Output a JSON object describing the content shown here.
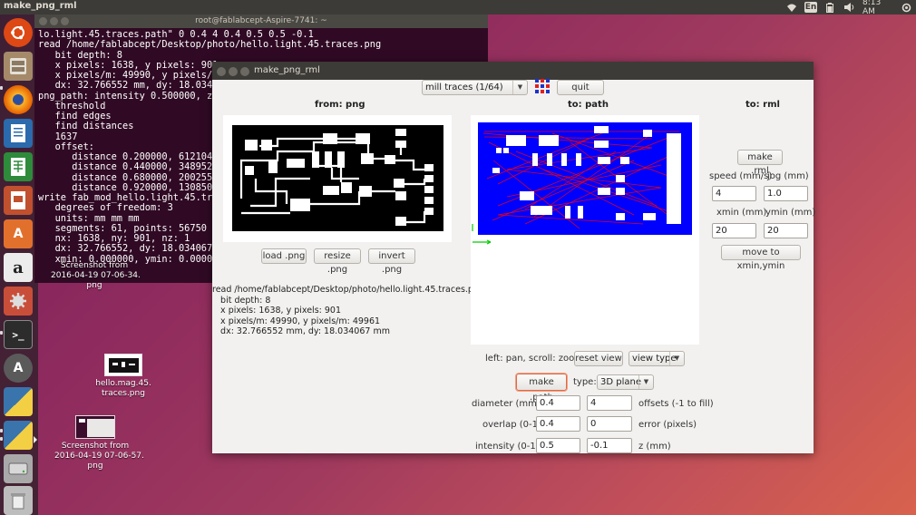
{
  "top_panel": {
    "title": "make_png_rml",
    "keyboard": "En",
    "time": "8:13 AM"
  },
  "launcher": {
    "items": [
      {
        "name": "ubuntu-dash",
        "icon": "ubuntu-logo-icon",
        "color": "#e0652c"
      },
      {
        "name": "files",
        "icon": "file-cabinet-icon",
        "color": "#8a6e55"
      },
      {
        "name": "firefox",
        "icon": "firefox-icon",
        "color": "#e66000"
      },
      {
        "name": "writer",
        "icon": "document-writer-icon",
        "color": "#2a6aad"
      },
      {
        "name": "calc",
        "icon": "spreadsheet-calc-icon",
        "color": "#2e8b3b"
      },
      {
        "name": "impress",
        "icon": "presentation-impress-icon",
        "color": "#c0502e"
      },
      {
        "name": "software-center",
        "icon": "shopping-bag-icon",
        "color": "#e2702d"
      },
      {
        "name": "amazon",
        "icon": "amazon-icon",
        "color": "#e9e9e9"
      },
      {
        "name": "settings",
        "icon": "gear-icon",
        "color": "#c94e39"
      },
      {
        "name": "terminal",
        "icon": "terminal-icon",
        "color": "#2c2c2c"
      },
      {
        "name": "updater",
        "icon": "update-icon",
        "color": "#6d6d6d"
      },
      {
        "name": "python-a",
        "icon": "python-icon",
        "color": "#3a74ad"
      },
      {
        "name": "python-b",
        "icon": "python-icon",
        "color": "#3a74ad"
      },
      {
        "name": "drive",
        "icon": "disk-drive-icon",
        "color": "#9b9b9b"
      },
      {
        "name": "trash",
        "icon": "trash-icon",
        "color": "#bdbdbd"
      }
    ]
  },
  "terminal": {
    "title": "root@fablabcept-Aspire-7741: ~",
    "text": "lo.light.45.traces.path\" 0 0.4 4 0.4 0.5 0.5 -0.1\nread /home/fablabcept/Desktop/photo/hello.light.45.traces.png\n   bit depth: 8\n   x pixels: 1638, y pixels: 901\n   x pixels/m: 49990, y pixels/m: \n   dx: 32.766552 mm, dy: 18.034067\npng_path: intensity 0.500000, z -\n   threshold\n   find edges\n   find distances\n   1637\n   offset:\n      distance 0.200000, 612104 \n      distance 0.440000, 348952 ex\n      distance 0.680000, 200255 ex\n      distance 0.920000, 130850 ex\nwrite fab_mod_hello.light.45.traces\n   degrees of freedom: 3\n   units: mm mm mm\n   segments: 61, points: 56750\n   nx: 1638, ny: 901, nz: 1\n   dx: 32.766552, dy: 18.034067, d\n   xmin: 0.000000, ymin: 0.000000,"
  },
  "desktop": {
    "icons": [
      {
        "label": "Screenshot from\n2016-04-19 07-06-34.\npng"
      },
      {
        "label": "hello.mag.45.\ntraces.png"
      },
      {
        "label": "Screenshot from\n2016-04-19 07-06-57.\npng"
      }
    ]
  },
  "window": {
    "title": "make_png_rml",
    "toolbar": {
      "mode_select": "mill traces (1/64)",
      "quit": "quit"
    },
    "from_png": {
      "heading": "from: png",
      "load": "load .png",
      "resize": "resize .png",
      "invert": "invert .png",
      "read_info": "read /home/fablabcept/Desktop/photo/hello.light.45.traces.png\n   bit depth: 8\n   x pixels: 1638, y pixels: 901\n   x pixels/m: 49990, y pixels/m: 49961\n   dx: 32.766552 mm, dy: 18.034067 mm"
    },
    "to_path": {
      "heading": "to: path",
      "hint": "left: pan, scroll: zoom",
      "reset_view": "reset view",
      "view_type": "view type",
      "make_path": "make .path",
      "type_label": "type:",
      "type_value": "3D plane",
      "diameter_label": "diameter (mm)",
      "diameter_value": "0.4",
      "offsets_value": "4",
      "offsets_label": "offsets (-1 to fill)",
      "overlap_label": "overlap (0-1)",
      "overlap_value": "0.4",
      "error_value": "0",
      "error_label": "error (pixels)",
      "intensity_label": "intensity (0-1)",
      "intensity_value": "0.5",
      "z_value": "-0.1",
      "z_label": "z (mm)"
    },
    "to_rml": {
      "heading": "to: rml",
      "make_rml": "make .rml",
      "speed_label": "speed (mm/s)",
      "jog_label": "jog (mm)",
      "speed_value": "4",
      "jog_value": "1.0",
      "xmin_label": "xmin (mm)",
      "ymin_label": "ymin (mm)",
      "xmin_value": "20",
      "ymin_value": "20",
      "move": "move to xmin,ymin"
    }
  },
  "colors": {
    "path_background": "#0000ff",
    "path_lines": "#ff0000",
    "axis_x": "#00cc00",
    "axis_y": "#00cc00"
  }
}
